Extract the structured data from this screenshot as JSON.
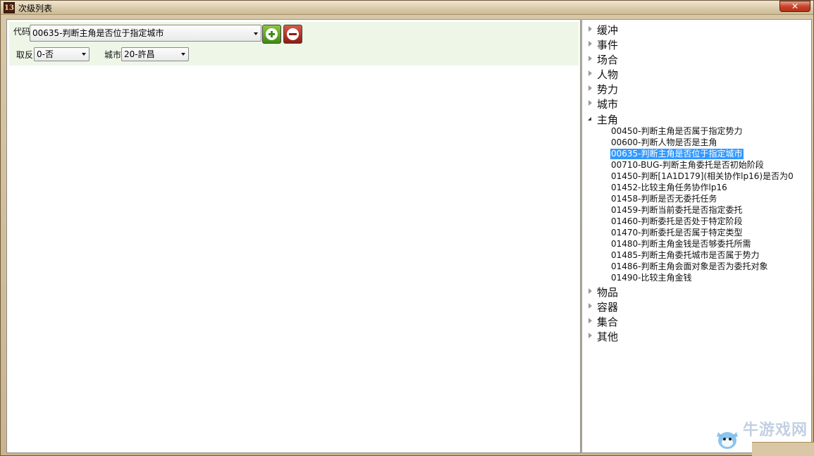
{
  "window": {
    "title": "次级列表",
    "app_icon_text": "13",
    "close_symbol": "✕"
  },
  "filters": {
    "code_label": "代码",
    "code_value": "00635-判断主角是否位于指定城市",
    "negate_label": "取反",
    "negate_value": "0-否",
    "city_label": "城市",
    "city_value": "20-許昌"
  },
  "tree": {
    "categories": [
      {
        "label": "缓冲",
        "expanded": false
      },
      {
        "label": "事件",
        "expanded": false
      },
      {
        "label": "场合",
        "expanded": false
      },
      {
        "label": "人物",
        "expanded": false
      },
      {
        "label": "势力",
        "expanded": false
      },
      {
        "label": "城市",
        "expanded": false
      },
      {
        "label": "主角",
        "expanded": true
      },
      {
        "label": "物品",
        "expanded": false
      },
      {
        "label": "容器",
        "expanded": false
      },
      {
        "label": "集合",
        "expanded": false
      },
      {
        "label": "其他",
        "expanded": false
      }
    ],
    "protagonist_items": [
      "00450-判断主角是否属于指定势力",
      "00600-判断人物是否是主角",
      "00635-判断主角是否位于指定城市",
      "00710-BUG-判断主角委托是否初始阶段",
      "01450-判断[1A1D179](相关协作lp16)是否为0",
      "01452-比较主角任务协作lp16",
      "01458-判断是否无委托任务",
      "01459-判断当前委托是否指定委托",
      "01460-判断委托是否处于特定阶段",
      "01470-判断委托是否属于特定类型",
      "01480-判断主角金钱是否够委托所需",
      "01485-判断主角委托城市是否属于势力",
      "01486-判断主角会面对象是否为委托对象",
      "01490-比较主角金钱"
    ],
    "selected_item": "00635-判断主角是否位于指定城市"
  },
  "watermark": {
    "text": "牛游戏网"
  },
  "colors": {
    "selection": "#3399ff",
    "filter_band": "#eef6e8",
    "add_button": "#3f8a12",
    "remove_button": "#8e1a10"
  }
}
